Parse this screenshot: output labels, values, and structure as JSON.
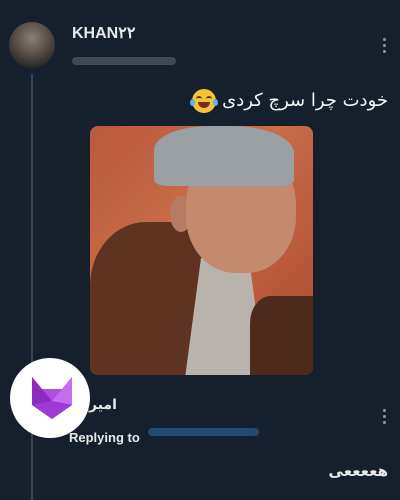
{
  "tweet": {
    "author_name": "KHAN۲۲",
    "text": "خودت چرا سرچ کردی",
    "emoji": "face-with-tears-of-joy-icon"
  },
  "reply": {
    "author_name": "امیر",
    "replying_to_label": "Replying to",
    "text": "هععععی"
  },
  "colors": {
    "background": "#16202c",
    "text": "#e7e9ea",
    "muted": "#8b98a5",
    "fox_purple": "#b14ee0"
  }
}
